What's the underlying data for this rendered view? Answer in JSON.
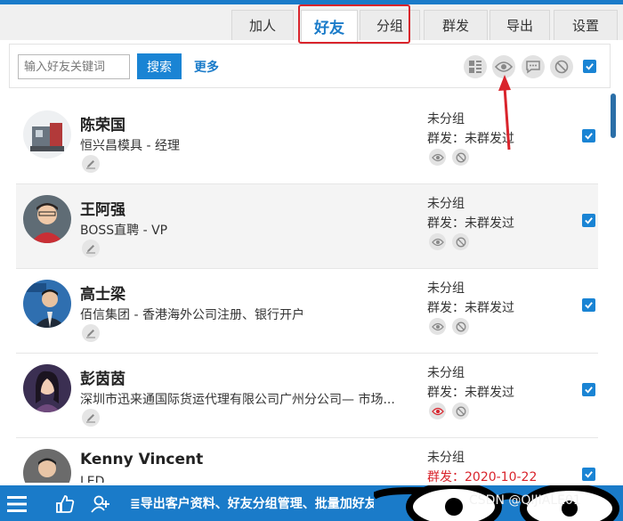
{
  "tabs": [
    {
      "label": "加人",
      "active": false
    },
    {
      "label": "好友",
      "active": true
    },
    {
      "label": "分组",
      "active": false
    },
    {
      "label": "群发",
      "active": false
    },
    {
      "label": "导出",
      "active": false
    },
    {
      "label": "设置",
      "active": false
    }
  ],
  "toolbar": {
    "search_placeholder": "输入好友关键词",
    "search_label": "搜索",
    "more_label": "更多",
    "icons": [
      "grid-view-icon",
      "eye-icon",
      "chat-icon",
      "ban-icon"
    ],
    "select_all_checked": true
  },
  "friends": [
    {
      "name": "陈荣国",
      "company": "恒兴昌模具 - 经理",
      "group": "未分组",
      "send_status": "群发：未群发过",
      "send_highlight": false,
      "eye_red": false,
      "checked": true
    },
    {
      "name": "王阿强",
      "company": "BOSS直聘 - VP",
      "group": "未分组",
      "send_status": "群发：未群发过",
      "send_highlight": false,
      "eye_red": false,
      "checked": true
    },
    {
      "name": "高士梁",
      "company": "佰信集团 - 香港海外公司注册、银行开户",
      "group": "未分组",
      "send_status": "群发：未群发过",
      "send_highlight": false,
      "eye_red": false,
      "checked": true
    },
    {
      "name": "彭茵茵",
      "company": "深圳市迅来通国际货运代理有限公司广州分公司— 市场...",
      "group": "未分组",
      "send_status": "群发：未群发过",
      "send_highlight": false,
      "eye_red": true,
      "checked": true
    },
    {
      "name": "Kenny Vincent",
      "company": "LED",
      "group": "未分组",
      "send_status": "群发：2020-10-22",
      "send_highlight": true,
      "eye_red": false,
      "checked": true
    }
  ],
  "bottom_bar": {
    "text": "≣导出客户资料、好友分组管理、批量加好友"
  },
  "watermark": "CSDN @QIJIALE01",
  "colors": {
    "accent": "#1a7bc9",
    "highlight": "#d9242c"
  }
}
